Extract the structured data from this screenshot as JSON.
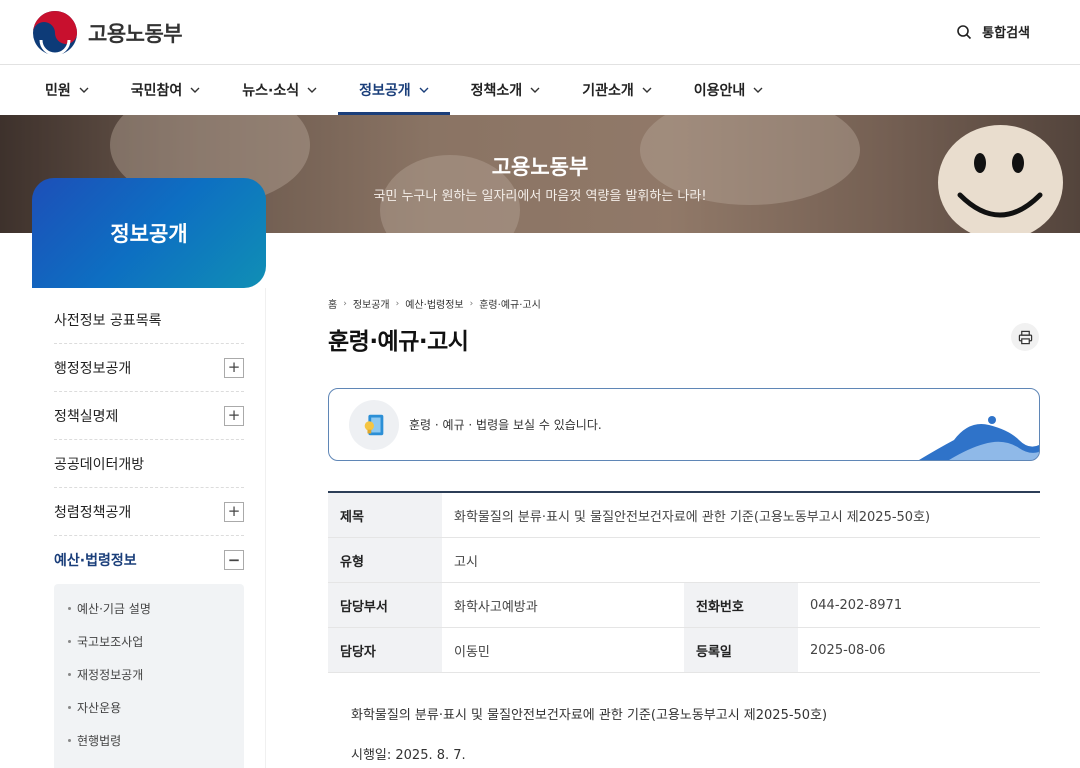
{
  "header": {
    "logo_text": "고용노동부",
    "search_label": "통합검색"
  },
  "gnb": [
    {
      "label": "민원"
    },
    {
      "label": "국민참여"
    },
    {
      "label": "뉴스·소식"
    },
    {
      "label": "정보공개",
      "active": true
    },
    {
      "label": "정책소개"
    },
    {
      "label": "기관소개"
    },
    {
      "label": "이용안내"
    }
  ],
  "banner": {
    "title": "고용노동부",
    "subtitle": "국민 누구나 원하는 일자리에서 마음껏 역량을 발휘하는 나라!"
  },
  "sidebar": {
    "title": "정보공개",
    "items": [
      {
        "label": "사전정보 공표목록",
        "toggle": ""
      },
      {
        "label": "행정정보공개",
        "toggle": "+"
      },
      {
        "label": "정책실명제",
        "toggle": "+"
      },
      {
        "label": "공공데이터개방",
        "toggle": ""
      },
      {
        "label": "청렴정책공개",
        "toggle": "+"
      },
      {
        "label": "예산·법령정보",
        "toggle": "−"
      }
    ],
    "sub_items": [
      {
        "label": "예산·기금 설명"
      },
      {
        "label": "국고보조사업"
      },
      {
        "label": "재정정보공개"
      },
      {
        "label": "자산운용"
      },
      {
        "label": "현행법령"
      }
    ]
  },
  "breadcrumb": [
    "홈",
    "정보공개",
    "예산·법령정보",
    "훈령·예규·고시"
  ],
  "page_title": "훈령·예규·고시",
  "info_box": {
    "text": "훈령 · 예규 · 법령을 보실 수 있습니다."
  },
  "detail": {
    "title_label": "제목",
    "title_value": "화학물질의 분류·표시 및 물질안전보건자료에 관한 기준(고용노동부고시 제2025-50호)",
    "type_label": "유형",
    "type_value": "고시",
    "dept_label": "담당부서",
    "dept_value": "화학사고예방과",
    "phone_label": "전화번호",
    "phone_value": "044-202-8971",
    "person_label": "담당자",
    "person_value": "이동민",
    "date_label": "등록일",
    "date_value": "2025-08-06"
  },
  "body": {
    "line1": "화학물질의 분류·표시 및 물질안전보건자료에 관한 기준(고용노동부고시 제2025-50호)",
    "line2": "시행일: 2025. 8. 7."
  },
  "colors": {
    "brand_navy": "#1a3e7a",
    "sidebar_gradient_start": "#1d4fb8",
    "sidebar_gradient_end": "#108fb5",
    "info_border": "#5f86b6",
    "table_top_border": "#2c3e57"
  }
}
